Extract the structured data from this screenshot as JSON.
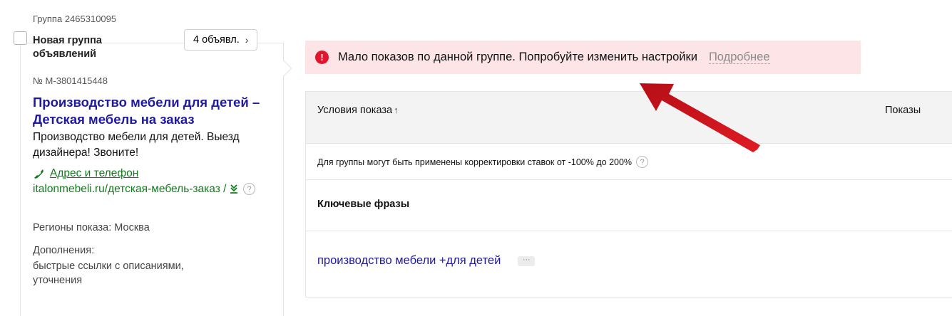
{
  "group": {
    "id_label": "Группа 2465310095",
    "name": "Новая группа объявлений",
    "ads_button": "4 объявл.",
    "ads_button_icon": "chevron-right-icon"
  },
  "ad": {
    "number": "№ М-3801415448",
    "title": "Производство мебели для детей – Детская мебель на заказ",
    "text": "Производство мебели для детей. Выезд дизайнера! Звоните!",
    "contact_link": "Адрес и телефон",
    "display_url": "italonmebeli.ru/детская-мебель-заказ /",
    "regions": "Регионы показа: Москва",
    "extras_label": "Дополнения:",
    "extras_value": "быстрые ссылки с описаниями, уточнения"
  },
  "alert": {
    "text": "Мало показов по данной группе. Попробуйте изменить настройки",
    "more_link": "Подробнее",
    "icon": "exclamation-icon",
    "color": "#e3142d",
    "background": "#fde4e7"
  },
  "table": {
    "col_conditions": "Условия показа",
    "sort_arrow": "↑",
    "col_shows": "Показы",
    "bid_note": "Для группы могут быть применены корректировки ставок от -100% до 200%",
    "keywords_header": "Ключевые фразы",
    "phrases": [
      "производство мебели +для детей"
    ],
    "more_button": "···"
  },
  "help_glyph": "?",
  "colors": {
    "title_link": "#1f1aa0",
    "green_link": "#107c1a",
    "annotation_arrow": "#d1131d"
  }
}
